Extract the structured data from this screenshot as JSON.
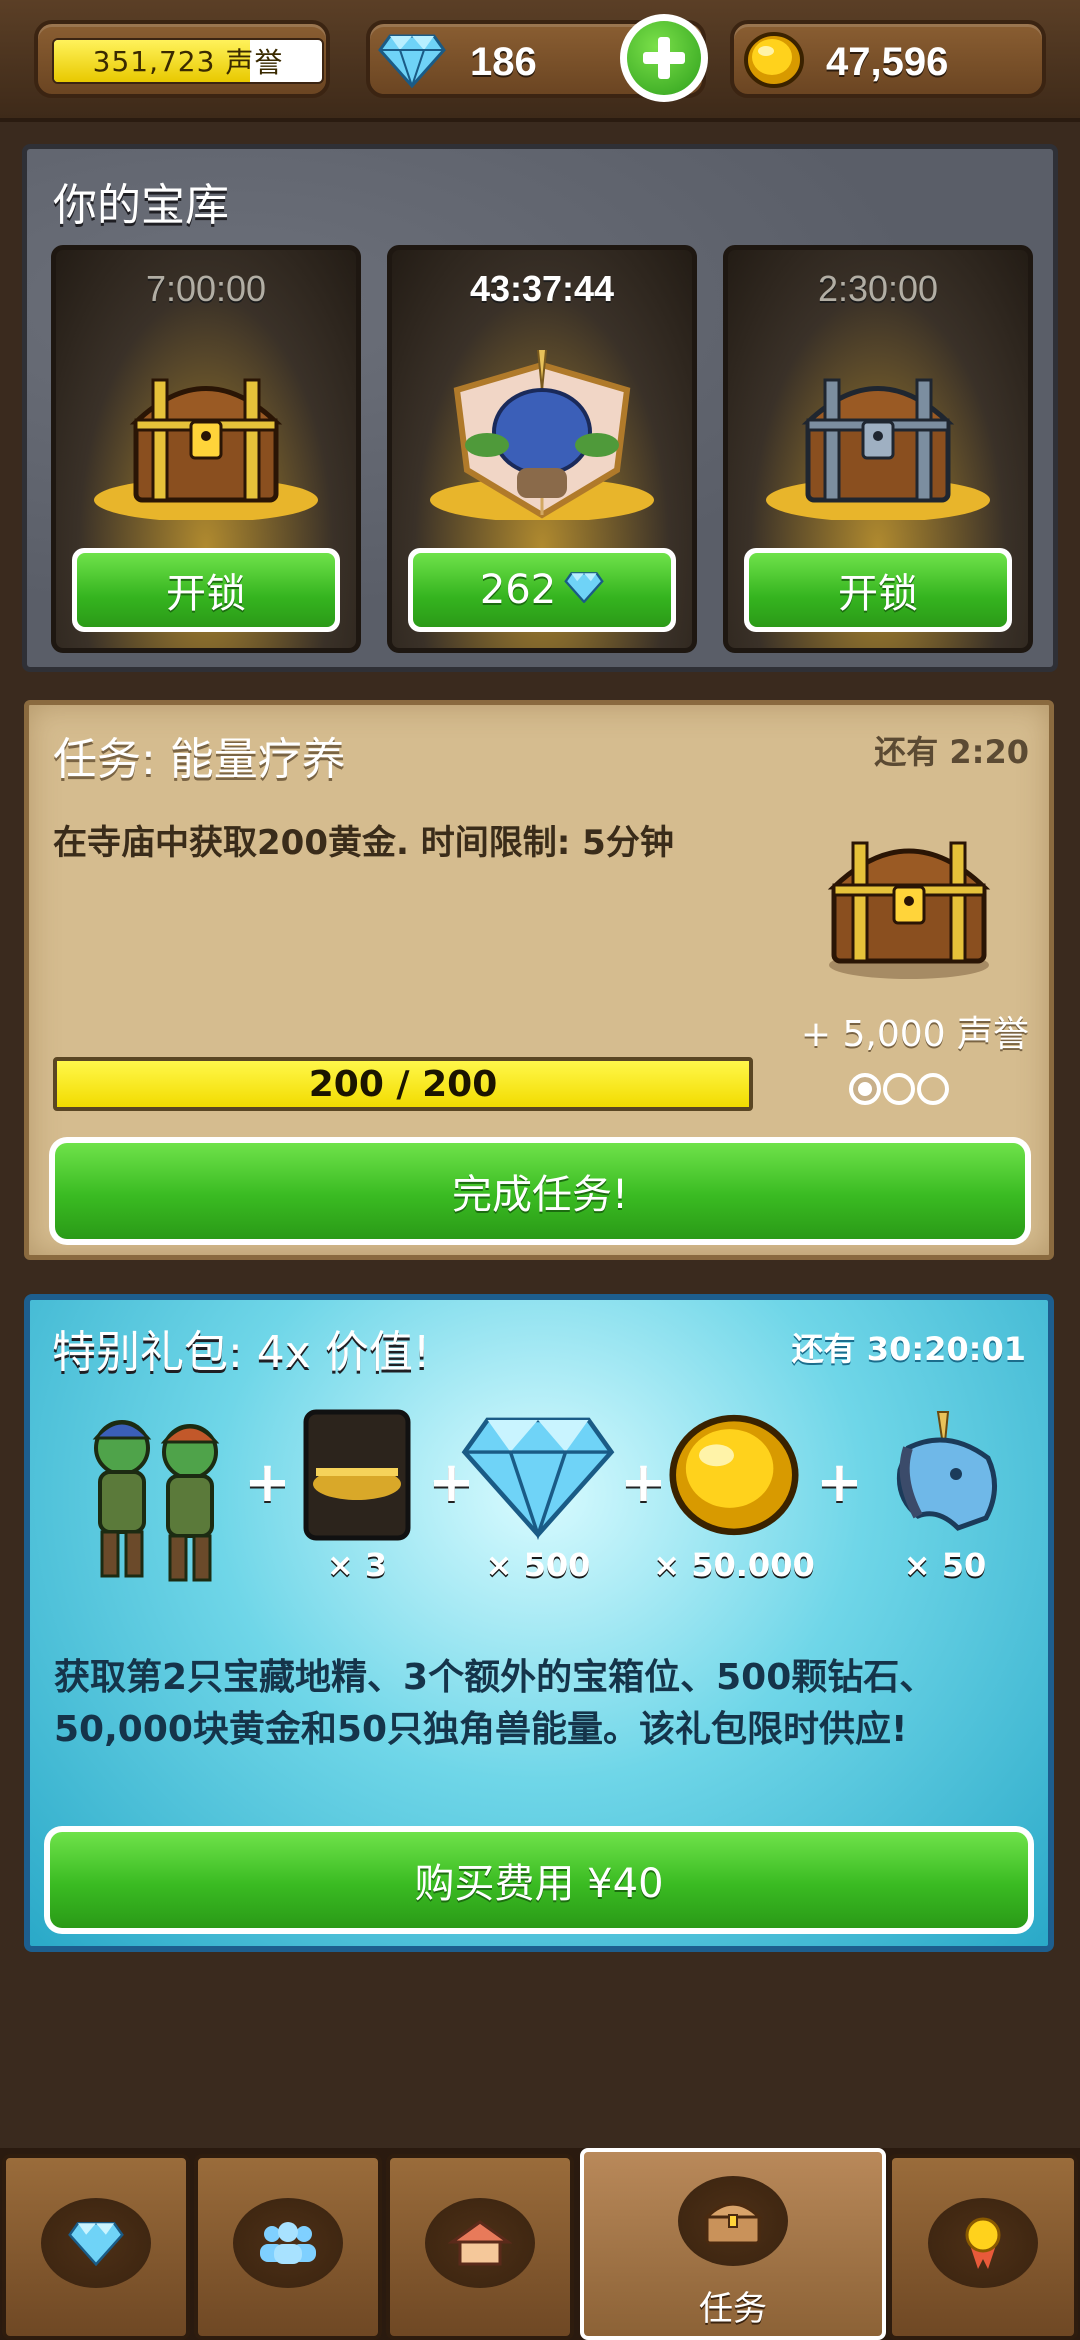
{
  "top_bar": {
    "reputation": {
      "value": "351,723",
      "unit": "声誉",
      "fill_fraction": 0.73
    },
    "gems": "186",
    "gold": "47,596"
  },
  "vault": {
    "title": "你的宝库",
    "chests": [
      {
        "timer": "7:00:00",
        "button": "开锁",
        "type": "gold-chest"
      },
      {
        "timer": "43:37:44",
        "button": "262",
        "type": "unicorn-shield",
        "button_icon": "gem-icon"
      },
      {
        "timer": "2:30:00",
        "button": "开锁",
        "type": "silver-chest"
      }
    ]
  },
  "quest": {
    "title": "任务: 能量疗养",
    "time_left": "还有 2:20",
    "description": "在寺庙中获取200黄金. 时间限制: 5分钟",
    "progress_text": "200 / 200",
    "progress_fraction": 1.0,
    "reward": "+ 5,000 声誉",
    "complete_button": "完成任务!"
  },
  "special_pack": {
    "title": "特别礼包:  4x 价值!",
    "time_left": "还有 30:20:01",
    "items": [
      {
        "icon": "goblins-icon",
        "qty": ""
      },
      {
        "icon": "chest-slot-icon",
        "qty": "× 3"
      },
      {
        "icon": "gem-icon",
        "qty": "× 500"
      },
      {
        "icon": "gold-coin-icon",
        "qty": "× 50.000"
      },
      {
        "icon": "unicorn-icon",
        "qty": "× 50"
      }
    ],
    "description": "获取第2只宝藏地精、3个额外的宝箱位、500颗钻石、50,000块黄金和50只独角兽能量。该礼包限时供应!",
    "buy_button": "购买费用 ¥40"
  },
  "bottom_nav": {
    "tabs": [
      {
        "icon": "gem-icon",
        "label": ""
      },
      {
        "icon": "people-icon",
        "label": ""
      },
      {
        "icon": "house-icon",
        "label": ""
      },
      {
        "icon": "chest-icon",
        "label": "任务",
        "active": true
      },
      {
        "icon": "medal-icon",
        "label": ""
      }
    ]
  },
  "colors": {
    "accent_green": "#3abb22",
    "progress_yellow": "#f2dc00",
    "pack_blue": "#2aa9c8"
  }
}
